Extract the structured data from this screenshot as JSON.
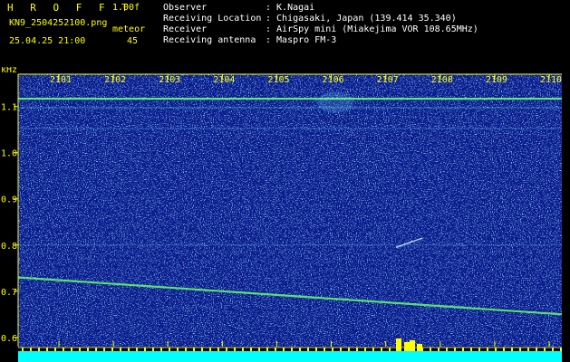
{
  "header": {
    "app_title": "H R O F F T",
    "version": "1.00f",
    "filename": "KN9_2504252100.png",
    "meteor_label": "meteor",
    "meteor_count": "45",
    "datetime": "25.04.25 21:00"
  },
  "info": [
    {
      "label": "Observer",
      "value": ": K.Nagai"
    },
    {
      "label": "Receiving Location",
      "value": ": Chigasaki, Japan (139.414 35.340)"
    },
    {
      "label": "Receiver",
      "value": ": AirSpy mini (Miakejima VOR 108.65MHz)"
    },
    {
      "label": "Receiving antenna",
      "value": ": Maspro FM-3"
    }
  ],
  "chart_data": {
    "type": "heatmap",
    "ylabel": "kHz",
    "y_ticks": [
      "1.1",
      "1.0",
      "0.9",
      "0.8",
      "0.7",
      "0.6"
    ],
    "y_tick_values": [
      1.1,
      1.0,
      0.9,
      0.8,
      0.7,
      0.6
    ],
    "x_ticks": [
      "2101",
      "2102",
      "2103",
      "2104",
      "2105",
      "2106",
      "2107",
      "2108",
      "2109",
      "2110"
    ],
    "ylim": [
      0.58,
      1.17
    ],
    "carrier_khz": 1.117,
    "drift_line_khz": [
      0.73,
      0.65
    ],
    "meteor_count": 45,
    "colors": {
      "background": "#0a1a8c",
      "noise": "#3a9aff",
      "signal": "#66ff66",
      "axis": "#ffff00",
      "activity": "#00ffff"
    }
  }
}
